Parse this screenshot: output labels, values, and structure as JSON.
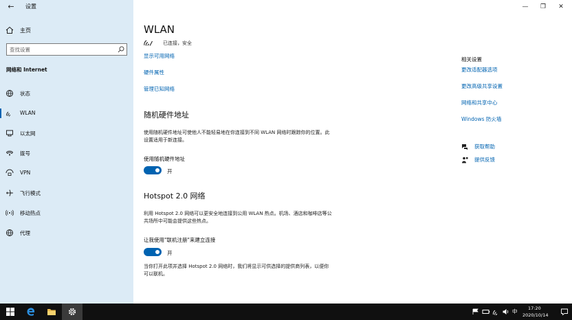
{
  "window": {
    "app_title": "设置",
    "back_icon": "back-arrow-icon",
    "minimize_glyph": "—",
    "restore_glyph": "❐",
    "close_glyph": "✕"
  },
  "sidebar": {
    "home_label": "主页",
    "search_placeholder": "查找设置",
    "section_title": "网络和 Internet",
    "items": [
      {
        "label": "状态",
        "icon": "globe-status-icon"
      },
      {
        "label": "WLAN",
        "icon": "wifi-icon",
        "active": true
      },
      {
        "label": "以太网",
        "icon": "ethernet-icon"
      },
      {
        "label": "拨号",
        "icon": "dialup-icon"
      },
      {
        "label": "VPN",
        "icon": "vpn-icon"
      },
      {
        "label": "飞行模式",
        "icon": "airplane-icon"
      },
      {
        "label": "移动热点",
        "icon": "hotspot-icon"
      },
      {
        "label": "代理",
        "icon": "proxy-globe-icon"
      }
    ]
  },
  "main": {
    "title": "WLAN",
    "connection_status": "已连接，安全",
    "links": {
      "show_networks": "显示可用网络",
      "hardware_props": "硬件属性",
      "manage_known": "管理已知网络"
    },
    "random_hw": {
      "heading": "随机硬件地址",
      "description": "使用随机硬件地址可使他人不能轻易地在你连接到不同 WLAN 网络时跟踪你的位置。此设置适用于新连接。",
      "option_label": "使用随机硬件地址",
      "toggle_state": "开"
    },
    "hotspot": {
      "heading": "Hotspot 2.0 网络",
      "description": "利用 Hotspot 2.0 网络可以更安全地连接到公用 WLAN 热点。机场、酒店和咖啡店等公共场所中可能会提供这些热点。",
      "option_label": "让我使用\"联机注册\"来建立连接",
      "toggle_state": "开",
      "footnote": "当你打开此项并选择 Hotspot 2.0 网络时，我们将显示可供选择的提供商列表，以便你可以联机。"
    }
  },
  "related": {
    "title": "相关设置",
    "links": [
      "更改适配器选项",
      "更改高级共享设置",
      "网络和共享中心",
      "Windows 防火墙"
    ],
    "help": [
      {
        "label": "获取帮助",
        "icon": "help-chat-icon"
      },
      {
        "label": "提供反馈",
        "icon": "feedback-icon"
      }
    ]
  },
  "taskbar": {
    "ime_label": "中",
    "time": "17:20",
    "date": "2020/10/14"
  },
  "colors": {
    "accent": "#0063b1",
    "sidebar_bg": "#dcebf6",
    "taskbar_bg": "#101010"
  }
}
